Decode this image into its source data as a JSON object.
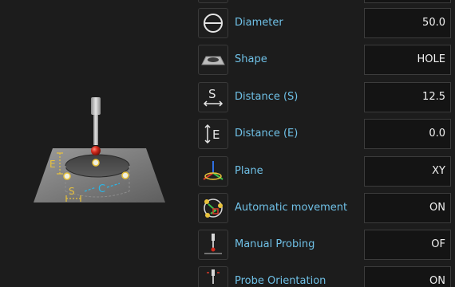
{
  "illustration": {
    "dimension_e": "E",
    "dimension_s": "S",
    "dimension_c": "C"
  },
  "parameters": [
    {
      "label": "Diameter",
      "value": "50.0",
      "icon": "diameter-icon"
    },
    {
      "label": "Shape",
      "value": "HOLE",
      "icon": "shape-icon"
    },
    {
      "label": "Distance (S)",
      "value": "12.5",
      "icon": "distance-s-icon",
      "icon_text": "S"
    },
    {
      "label": "Distance (E)",
      "value": "0.0",
      "icon": "distance-e-icon",
      "icon_text": "E"
    },
    {
      "label": "Plane",
      "value": "XY",
      "icon": "plane-axes-icon"
    },
    {
      "label": "Automatic movement",
      "value": "ON",
      "icon": "automatic-movement-icon"
    },
    {
      "label": "Manual Probing",
      "value": "OF",
      "icon": "manual-probe-icon"
    },
    {
      "label": "Probe Orientation",
      "value": "ON",
      "icon": "probe-orientation-icon"
    }
  ],
  "colors": {
    "background": "#1c1c1c",
    "label": "#6fc0e6",
    "value": "#f0f0f0",
    "dimension_e": "#e8c23c",
    "dimension_c": "#29b6e8",
    "probe_ball": "#d32a1c"
  }
}
